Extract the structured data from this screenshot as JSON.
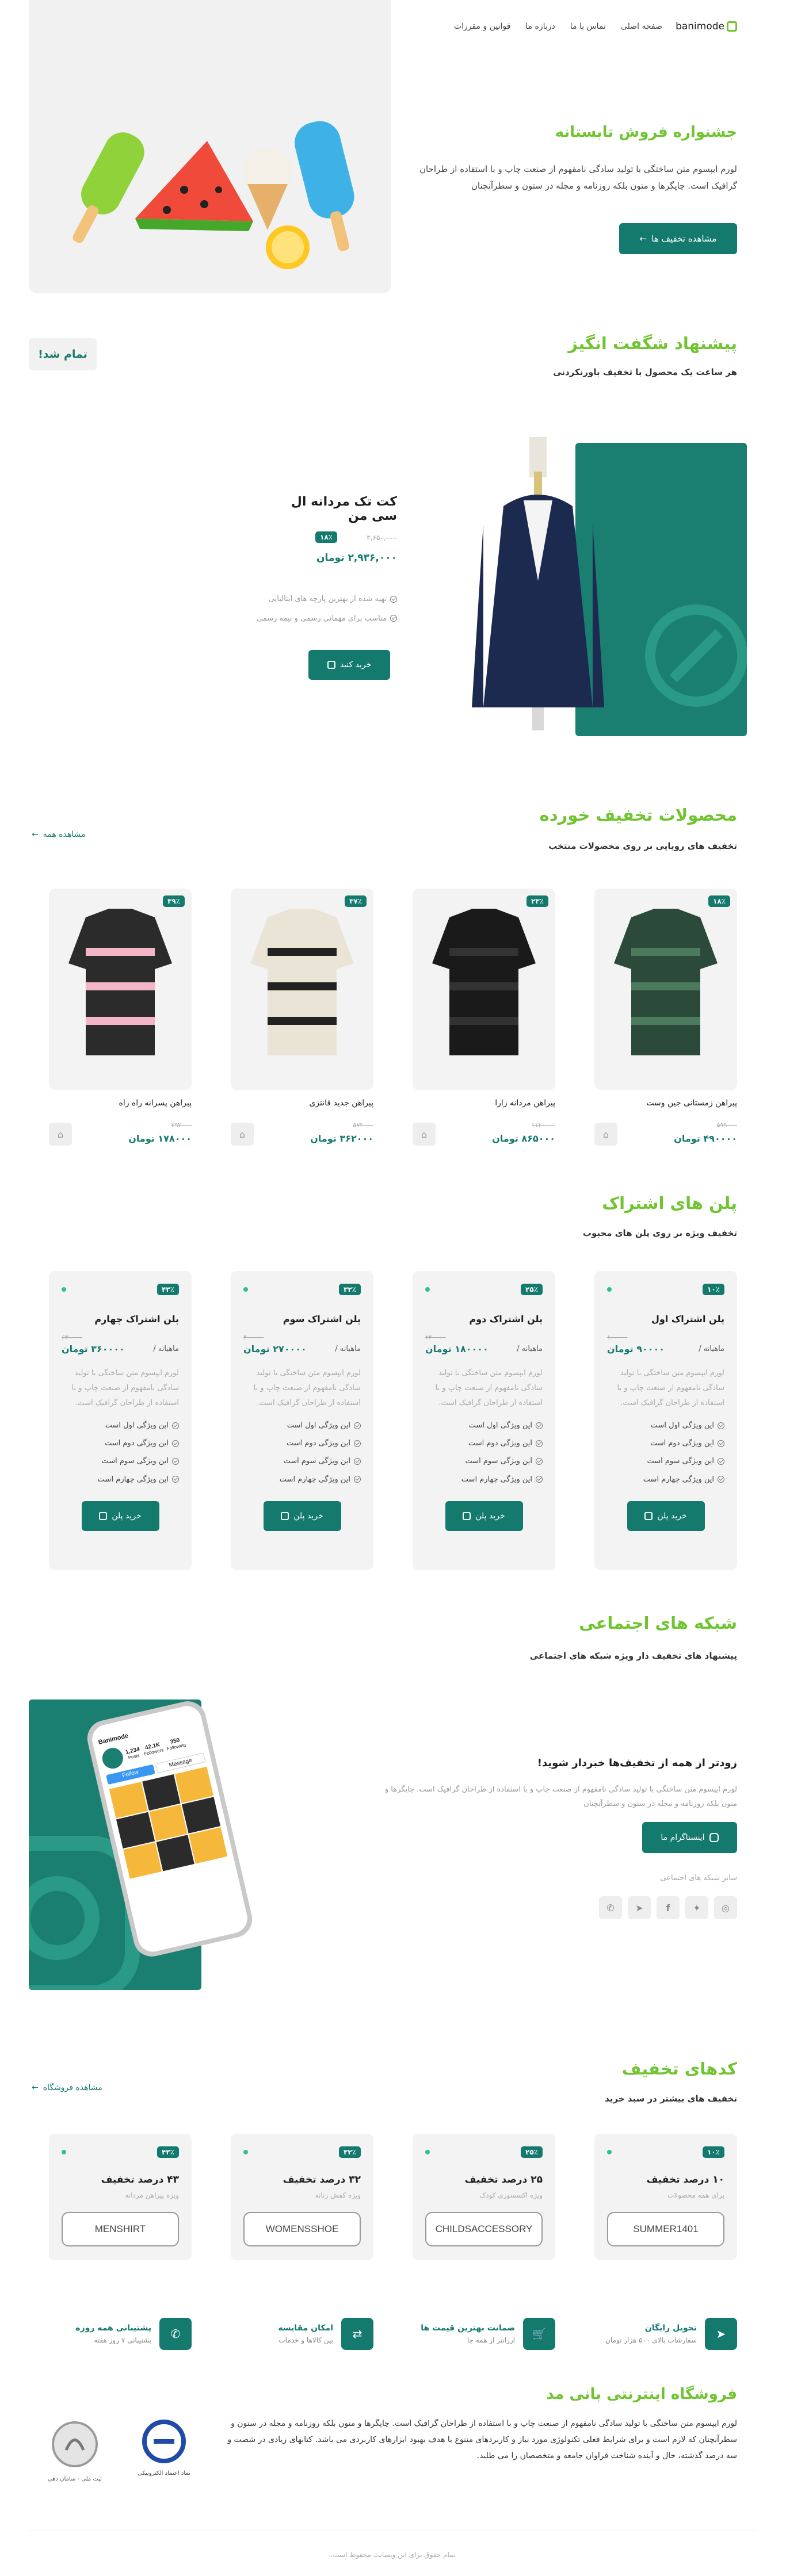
{
  "header": {
    "logo_text": "banimode",
    "nav": [
      "صفحه اصلی",
      "تماس با ما",
      "درباره ما",
      "قوانین و مقررات"
    ]
  },
  "hero": {
    "title": "جشنواره فروش تابستانه",
    "text": "لورم ایپسوم متن ساختگی با تولید سادگی نامفهوم از صنعت چاپ و با استفاده از طراحان گرافیک است. چاپگرها و متون بلکه روزنامه و مجله در ستون و سطرآنچنان",
    "button": "مشاهده تخفیف ها"
  },
  "offer": {
    "title": "پیشنهاد شگفت انگیز",
    "subtitle": "هر ساعت یک محصول با تخفیف باورنکردنی",
    "timer": "تمام شد!",
    "product_name": "کت تک مردانه ال سی من",
    "old_price": "۳,۶۵۰,۰۰۰",
    "discount": "۱۸٪",
    "new_price": "۲,۹۳۶,۰۰۰ تومان",
    "features": [
      "تهیه شده از بهترین پارچه های ایتالیایی",
      "مناسب برای مهمانی رسمی و نیمه رسمی"
    ],
    "button": "خرید کنید"
  },
  "discounted": {
    "title": "محصولات تخفیف خورده",
    "subtitle": "تخفیف های رویایی بر روی محصولات منتخب",
    "see_all": "مشاهده همه",
    "products": [
      {
        "name": "پیراهن زمستانی جین وست",
        "badge": "۱۸٪",
        "old": "۵۹۹۰۰۰",
        "price": "۴۹۰۰۰۰ تومان"
      },
      {
        "name": "پیراهن مردانه زارا",
        "badge": "۲۳٪",
        "old": "۱۱۲۰۰۰۰",
        "price": "۸۶۵۰۰۰ تومان"
      },
      {
        "name": "پیراهن جدید فانتزی",
        "badge": "۳۷٪",
        "old": "۵۷۲۰۰۰",
        "price": "۳۶۲۰۰۰ تومان"
      },
      {
        "name": "پیراهن پسرانه راه راه",
        "badge": "۳۹٪",
        "old": "۲۹۲۰۰۰",
        "price": "۱۷۸۰۰۰ تومان"
      }
    ]
  },
  "plans": {
    "title": "پلن های اشتراک",
    "subtitle": "تخفیف ویژه بر روی پلن های محبوب",
    "items": [
      {
        "name": "پلن اشتراک اول",
        "badge": "۱۰٪",
        "old": "۱۰۰۰۰۰",
        "monthly": "ماهیانه /",
        "price": "۹۰۰۰۰ تومان"
      },
      {
        "name": "پلن اشتراک دوم",
        "badge": "۲۵٪",
        "old": "۲۴۰۰۰۰",
        "monthly": "ماهیانه /",
        "price": "۱۸۰۰۰۰ تومان"
      },
      {
        "name": "پلن اشتراک سوم",
        "badge": "۳۲٪",
        "old": "۴۰۰۰۰۰",
        "monthly": "ماهیانه /",
        "price": "۲۷۰۰۰۰ تومان"
      },
      {
        "name": "پلن اشتراک چهارم",
        "badge": "۴۳٪",
        "old": "۶۳۰۰۰۰",
        "monthly": "ماهیانه /",
        "price": "۳۶۰۰۰۰ تومان"
      }
    ],
    "desc": "لورم ایپسوم متن ساختگی با تولید سادگی نامفهوم از صنعت چاپ و با استفاده از طراحان گرافیک است.",
    "features": [
      "این ویژگی اول است",
      "این ویژگی دوم است",
      "این ویژگی سوم است",
      "این ویژگی چهارم است"
    ],
    "button": "خرید پلن"
  },
  "social": {
    "title": "شبکه های اجتماعی",
    "subtitle": "پیشنهاد های تخفیف دار ویژه شبکه های اجتماعی",
    "heading": "زودتر از همه از تخفیف‌ها خبردار شوید!",
    "text": "لورم ایپسوم متن ساختگی با تولید سادگی نامفهوم از صنعت چاپ و با استفاده از طراحان گرافیک است. چاپگرها و متون بلکه روزنامه و مجله در ستون و سطرآنچنان",
    "button": "اینستاگرام ما",
    "others_label": "سایر شبکه های اجتماعی",
    "phone_username": "Banimode",
    "phone_stats": [
      {
        "v": "1,234",
        "l": "Posts"
      },
      {
        "v": "42.1K",
        "l": "Followers"
      },
      {
        "v": "350",
        "l": "Following"
      }
    ],
    "phone_follow": "Follow",
    "phone_message": "Message"
  },
  "codes": {
    "title": "کدهای تخفیف",
    "subtitle": "تخفیف های بیشتر در سبد خرید",
    "see_all": "مشاهده فروشگاه",
    "items": [
      {
        "title": "۱۰ درصد تخفیف",
        "badge": "۱۰٪",
        "desc": "برای همه محصولات",
        "code": "SUMMER1401"
      },
      {
        "title": "۲۵ درصد تخفیف",
        "badge": "۲۵٪",
        "desc": "ویژه اکسسوری کودک",
        "code": "CHILDSACCESSORY"
      },
      {
        "title": "۳۲ درصد تخفیف",
        "badge": "۳۲٪",
        "desc": "ویژه کفش زنانه",
        "code": "WOMENSSHOE"
      },
      {
        "title": "۴۳ درصد تخفیف",
        "badge": "۴۳٪",
        "desc": "ویژه پیراهن مردانه",
        "code": "MENSHIRT"
      }
    ]
  },
  "features": [
    {
      "title": "تحویل رایگان",
      "desc": "سفارشات بالای ۵۰۰ هزار تومان"
    },
    {
      "title": "ضمانت بهترین قیمت ها",
      "desc": "ارزانتر از همه جا"
    },
    {
      "title": "امکان مقایسه",
      "desc": "بین کالاها و خدمات"
    },
    {
      "title": "پشتیبانی همه روزه",
      "desc": "پشتیبانی ۷ روز هفته"
    }
  ],
  "about": {
    "title": "فروشگاه اینترنتی بانی مد",
    "text": "لورم ایپسوم متن ساختگی با تولید سادگی نامفهوم از صنعت چاپ و با استفاده از طراحان گرافیک است. چاپگرها و متون بلکه روزنامه و مجله در ستون و سطرآنچنان که لازم است و برای شرایط فعلی تکنولوژی مورد نیاز و کاربردهای متنوع با هدف بهبود ابزارهای کاربردی می باشد. کتابهای زیادی در شصت و سه درصد گذشته، حال و آینده شناخت فراوان جامعه و متخصصان را می طلبد.",
    "enamad_text": "نماد اعتماد الکترونیکی",
    "samandehi_text": "ثبت ملی - سامان دهی"
  },
  "footer": {
    "copyright": "تمام حقوق برای این وبسایت محفوظ است."
  },
  "colors": {
    "accent": "#157a6e",
    "brand_green": "#6fc430"
  }
}
